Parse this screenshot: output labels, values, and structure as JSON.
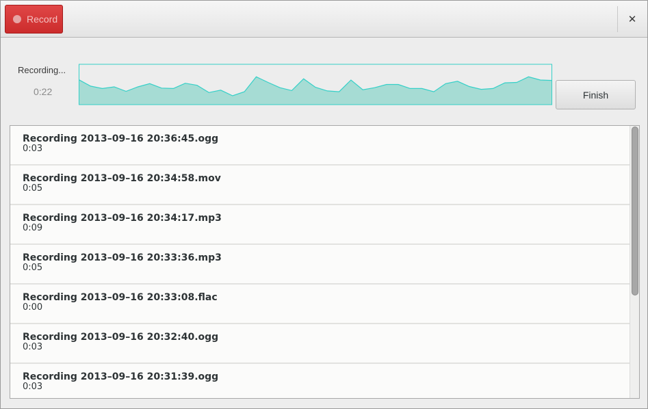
{
  "header": {
    "record_label": "Record",
    "close_glyph": "✕"
  },
  "recorder": {
    "status": "Recording...",
    "elapsed": "0:22",
    "finish_label": "Finish",
    "waveform_color": "#35d0c8",
    "waveform_fill": "#a6dcd4",
    "waveform_levels": [
      0.62,
      0.46,
      0.4,
      0.44,
      0.33,
      0.44,
      0.52,
      0.41,
      0.4,
      0.53,
      0.48,
      0.3,
      0.36,
      0.22,
      0.32,
      0.69,
      0.55,
      0.42,
      0.35,
      0.64,
      0.43,
      0.34,
      0.32,
      0.61,
      0.37,
      0.42,
      0.5,
      0.5,
      0.4,
      0.4,
      0.32,
      0.52,
      0.58,
      0.45,
      0.38,
      0.4,
      0.54,
      0.55,
      0.69,
      0.61,
      0.6
    ]
  },
  "recordings": [
    {
      "name": "Recording 2013–09–16 20:36:45.ogg",
      "duration": "0:03"
    },
    {
      "name": "Recording 2013–09–16 20:34:58.mov",
      "duration": "0:05"
    },
    {
      "name": "Recording 2013–09–16 20:34:17.mp3",
      "duration": "0:09"
    },
    {
      "name": "Recording 2013–09–16 20:33:36.mp3",
      "duration": "0:05"
    },
    {
      "name": "Recording 2013–09–16 20:33:08.flac",
      "duration": "0:00"
    },
    {
      "name": "Recording 2013–09–16 20:32:40.ogg",
      "duration": "0:03"
    },
    {
      "name": "Recording 2013–09–16 20:31:39.ogg",
      "duration": "0:03"
    }
  ]
}
